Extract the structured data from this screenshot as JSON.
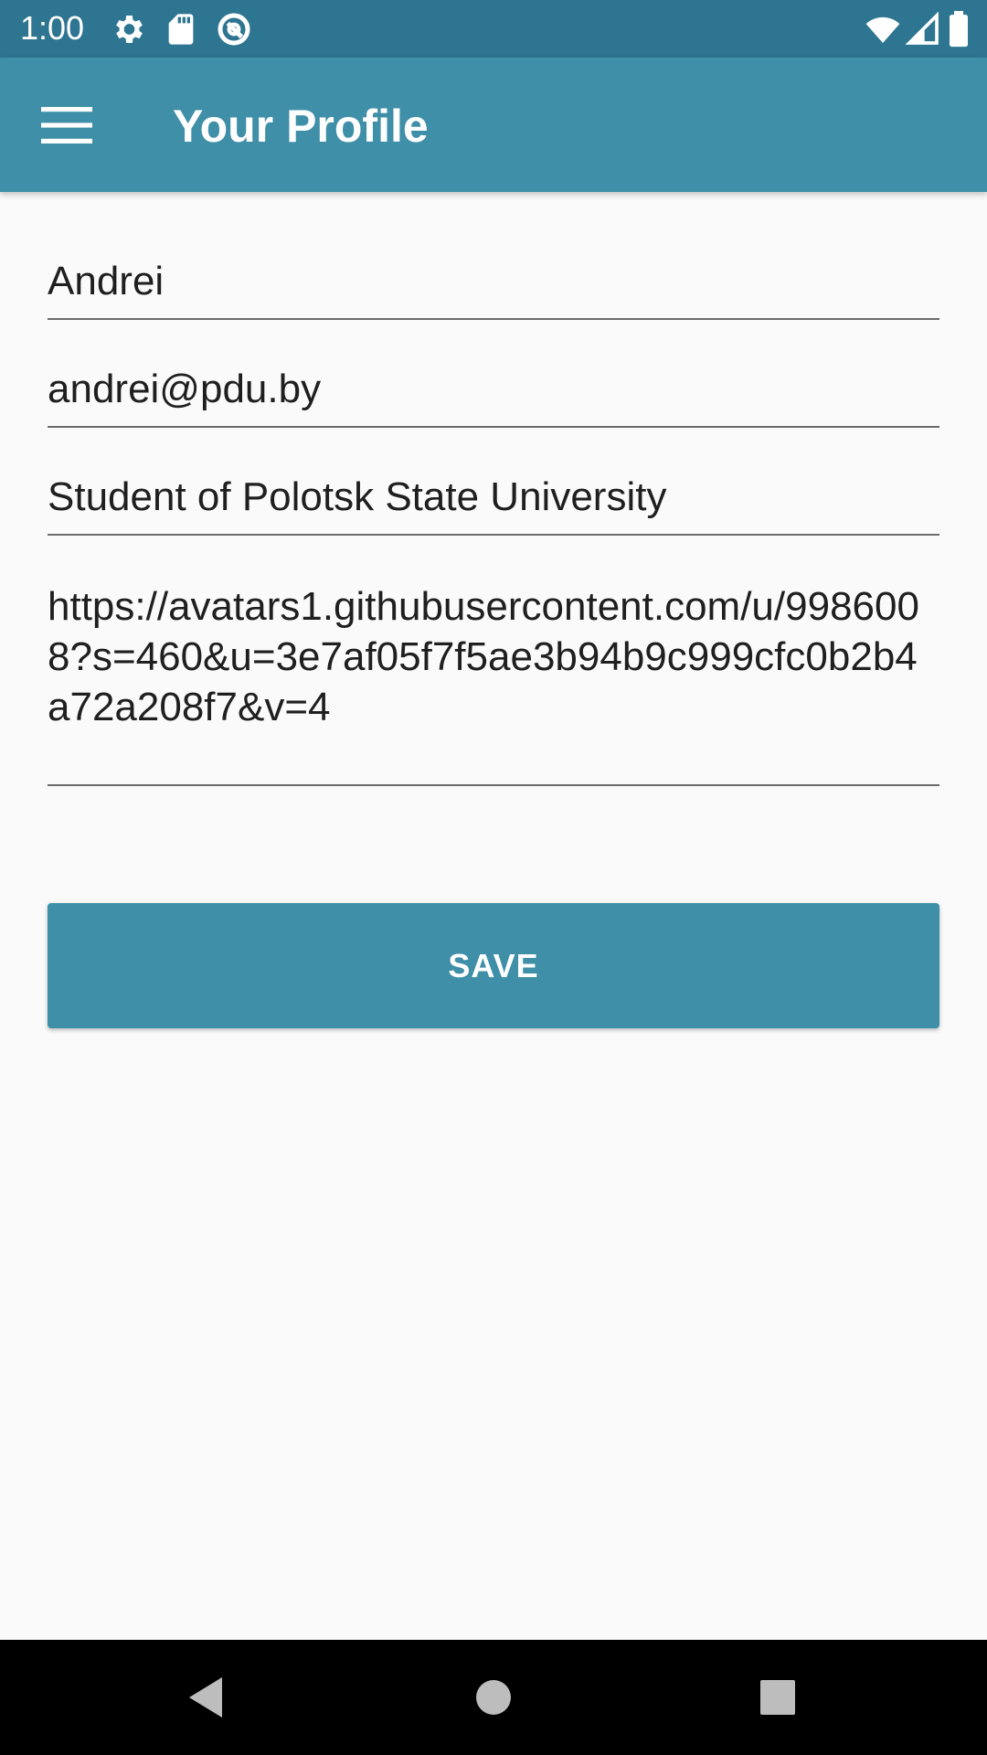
{
  "status_bar": {
    "time": "1:00",
    "left_icons": [
      "settings-icon",
      "sd-card-icon",
      "sync-icon"
    ],
    "right_icons": [
      "wifi-icon",
      "signal-icon",
      "battery-icon"
    ]
  },
  "app_bar": {
    "title": "Your Profile",
    "menu_icon": "hamburger-menu-icon"
  },
  "form": {
    "name": "Andrei",
    "email": "andrei@pdu.by",
    "about": "Student of Polotsk State University",
    "avatar_url": "https://avatars1.githubusercontent.com/u/9986008?s=460&u=3e7af05f7f5ae3b94b9c999cfc0b2b4a72a208f7&v=4"
  },
  "save_button": {
    "label": "SAVE"
  },
  "nav_bar": {
    "buttons": [
      "back-icon",
      "home-icon",
      "recents-icon"
    ]
  },
  "colors": {
    "status_bar": "#2e7591",
    "app_bar": "#3e8fa7",
    "accent": "#3e8fa7",
    "background": "#fafafa"
  }
}
